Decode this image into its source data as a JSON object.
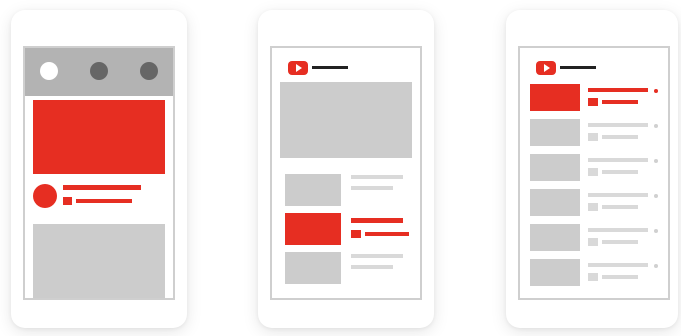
{
  "illustration": {
    "colors": {
      "accent": "#e62e22",
      "placeholder": "#cccccc",
      "frame": "#cfcfcf",
      "nav_dark": "#666666",
      "nav_bar": "#b3b3b3"
    },
    "phone_1": {
      "nav_icons": [
        "active-circle-icon",
        "circle-icon",
        "circle-icon"
      ]
    },
    "phone_2": {
      "logo_icon": "play-logo-icon",
      "list_rows": 3,
      "highlighted_row": 2
    },
    "phone_3": {
      "logo_icon": "play-logo-icon",
      "list_rows": 6,
      "highlighted_row": 1
    }
  }
}
